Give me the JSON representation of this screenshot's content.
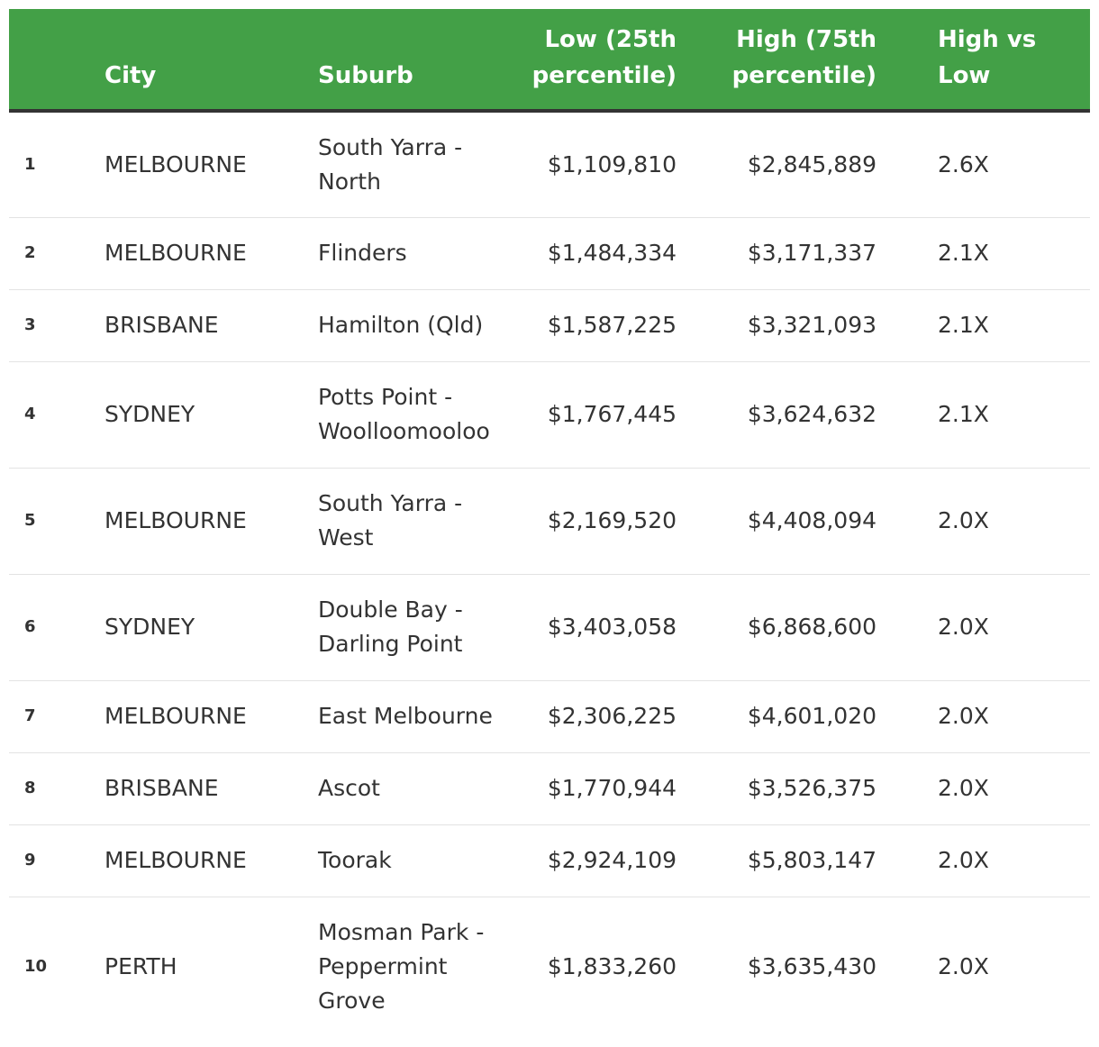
{
  "table": {
    "headers": {
      "rank": "",
      "city": "City",
      "suburb": "Suburb",
      "low": "Low (25th percentile)",
      "high": "High (75th percentile)",
      "ratio": "High vs Low"
    },
    "rows": [
      {
        "rank": "1",
        "city": "MELBOURNE",
        "suburb": "South Yarra - North",
        "low": "$1,109,810",
        "high": "$2,845,889",
        "ratio": "2.6X"
      },
      {
        "rank": "2",
        "city": "MELBOURNE",
        "suburb": "Flinders",
        "low": "$1,484,334",
        "high": "$3,171,337",
        "ratio": "2.1X"
      },
      {
        "rank": "3",
        "city": "BRISBANE",
        "suburb": "Hamilton (Qld)",
        "low": "$1,587,225",
        "high": "$3,321,093",
        "ratio": "2.1X"
      },
      {
        "rank": "4",
        "city": "SYDNEY",
        "suburb": "Potts Point - Woolloomooloo",
        "low": "$1,767,445",
        "high": "$3,624,632",
        "ratio": "2.1X"
      },
      {
        "rank": "5",
        "city": "MELBOURNE",
        "suburb": "South Yarra - West",
        "low": "$2,169,520",
        "high": "$4,408,094",
        "ratio": "2.0X"
      },
      {
        "rank": "6",
        "city": "SYDNEY",
        "suburb": "Double Bay - Darling Point",
        "low": "$3,403,058",
        "high": "$6,868,600",
        "ratio": "2.0X"
      },
      {
        "rank": "7",
        "city": "MELBOURNE",
        "suburb": "East Melbourne",
        "low": "$2,306,225",
        "high": "$4,601,020",
        "ratio": "2.0X"
      },
      {
        "rank": "8",
        "city": "BRISBANE",
        "suburb": "Ascot",
        "low": "$1,770,944",
        "high": "$3,526,375",
        "ratio": "2.0X"
      },
      {
        "rank": "9",
        "city": "MELBOURNE",
        "suburb": "Toorak",
        "low": "$2,924,109",
        "high": "$5,803,147",
        "ratio": "2.0X"
      },
      {
        "rank": "10",
        "city": "PERTH",
        "suburb": "Mosman Park - Peppermint Grove",
        "low": "$1,833,260",
        "high": "$3,635,430",
        "ratio": "2.0X"
      }
    ]
  },
  "colors": {
    "header_bg": "#43a047",
    "header_text": "#ffffff",
    "body_text": "#333333",
    "row_divider": "#e3e3e3",
    "header_rule": "#333333"
  }
}
